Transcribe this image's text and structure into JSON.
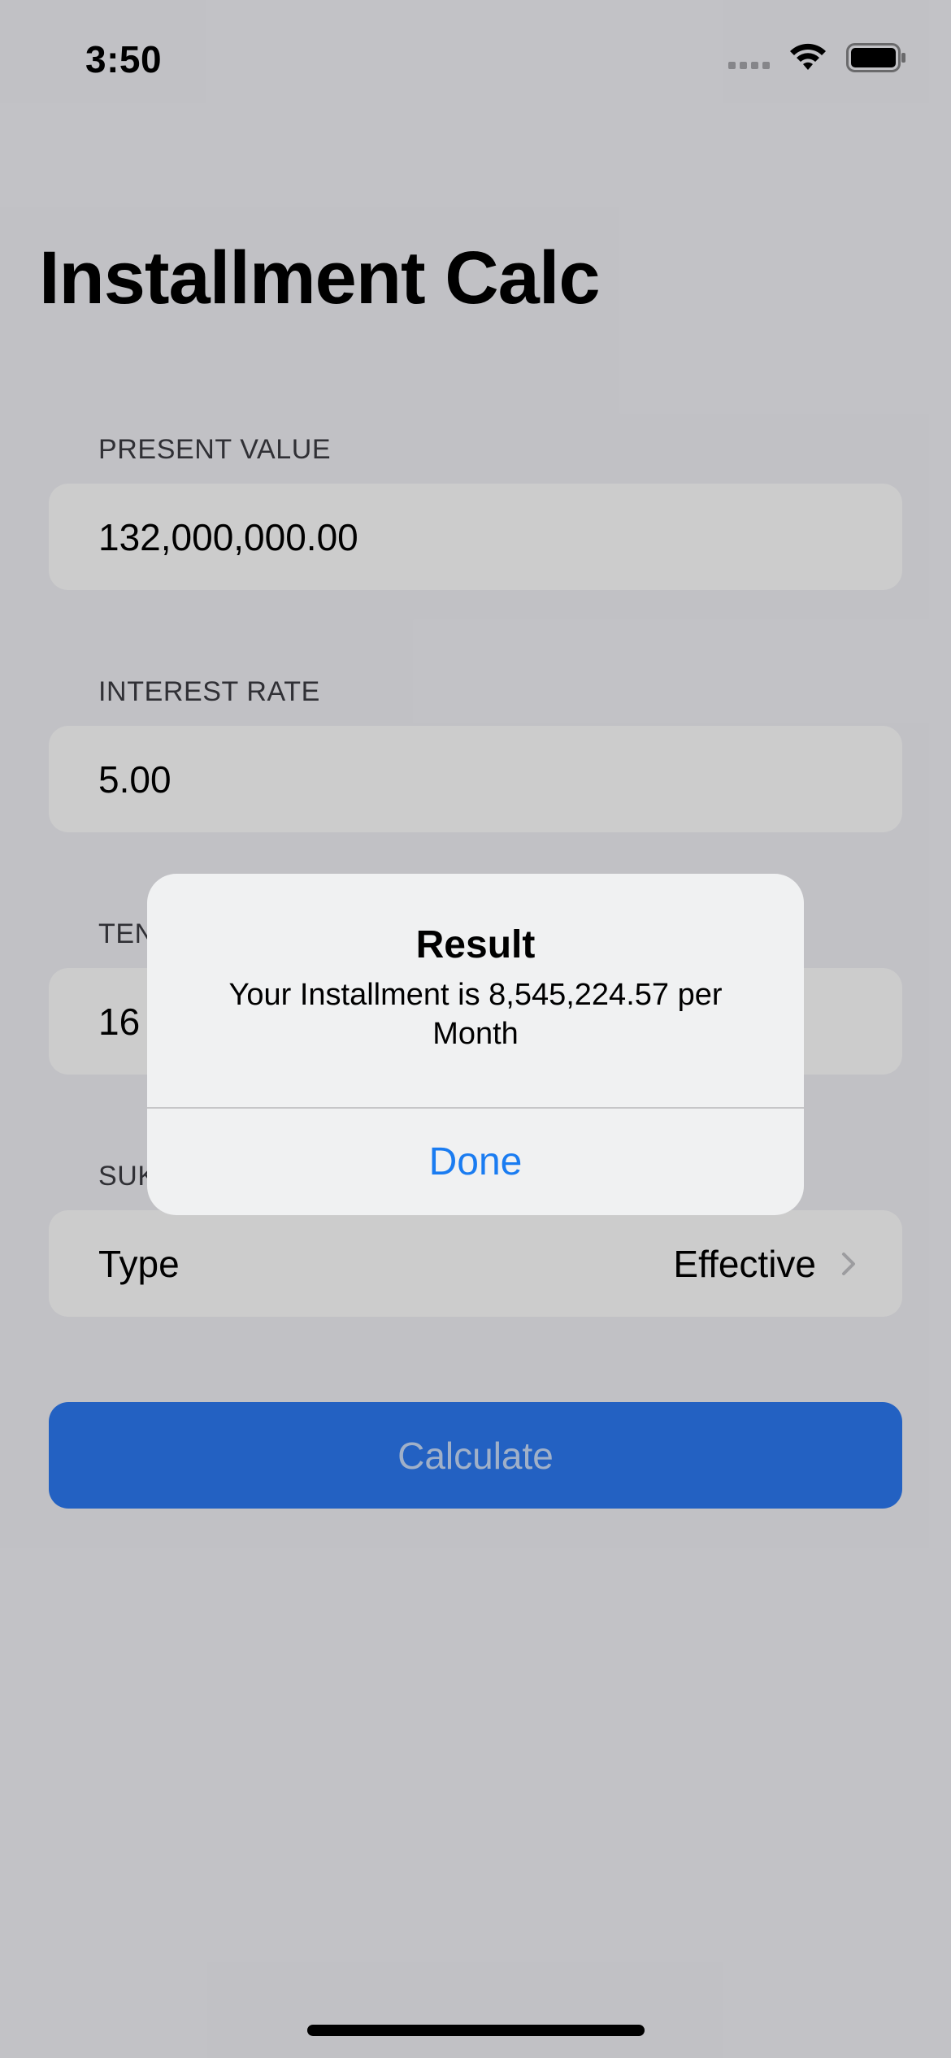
{
  "status_bar": {
    "time": "3:50"
  },
  "title": "Installment Calc",
  "fields": {
    "present_value": {
      "label": "PRESENT VALUE",
      "value": "132,000,000.00"
    },
    "interest_rate": {
      "label": "INTEREST RATE",
      "value": "5.00"
    },
    "tenor": {
      "label": "TEN",
      "value": "16"
    },
    "suku": {
      "label": "SUK",
      "row_label": "Type",
      "row_value": "Effective"
    }
  },
  "calculate_button": "Calculate",
  "alert": {
    "title": "Result",
    "message": "Your Installment is 8,545,224.57 per Month",
    "button": "Done"
  },
  "colors": {
    "accent": "#2c7af3",
    "alert_button": "#1a7cf1",
    "background": "#f2f2f7",
    "field": "#ffffff"
  },
  "icons": [
    "cellular-signal-icon",
    "wifi-icon",
    "battery-icon",
    "chevron-right-icon"
  ]
}
